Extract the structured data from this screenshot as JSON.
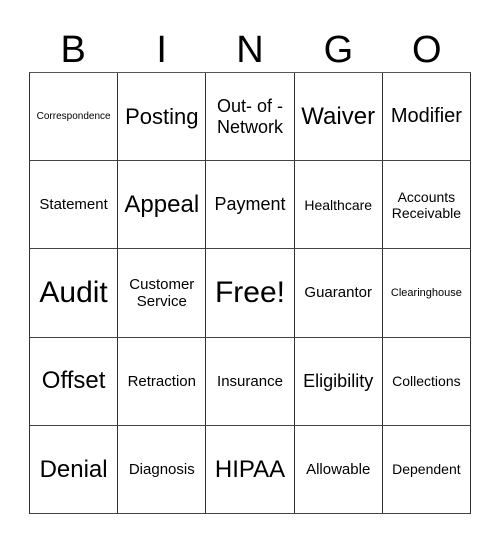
{
  "header": [
    "B",
    "I",
    "N",
    "G",
    "O"
  ],
  "cells": [
    [
      "Correspondence",
      "Posting",
      "Out- of - Network",
      "Waiver",
      "Modifier"
    ],
    [
      "Statement",
      "Appeal",
      "Payment",
      "Healthcare",
      "Accounts Receivable"
    ],
    [
      "Audit",
      "Customer Service",
      "Free!",
      "Guarantor",
      "Clearinghouse"
    ],
    [
      "Offset",
      "Retraction",
      "Insurance",
      "Eligibility",
      "Collections"
    ],
    [
      "Denial",
      "Diagnosis",
      "HIPAA",
      "Allowable",
      "Dependent"
    ]
  ]
}
